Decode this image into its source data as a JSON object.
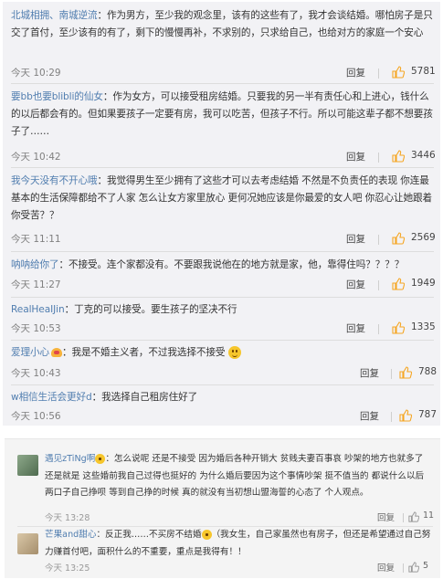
{
  "comments": [
    {
      "user": "北城相拥、南城逆流",
      "text": "：作为男方，至少我的观念里，该有的这些有了，我才会谈结婚。哪怕房子是只交了首付，至少该有的有了，剩下的慢慢再补，不求别的，只求给自己，也给对方的家庭一个安心",
      "time": "今天 10:29",
      "reply": "回复",
      "likes": "5781"
    },
    {
      "user": "要bb也要blibli的仙女",
      "text": "：作为女方，可以接受租房结婚。只要我的另一半有责任心和上进心，钱什么的以后都会有的。但如果要孩子一定要有房，我可以吃苦，但孩子不行。所以可能这辈子都不想要孩子了……",
      "time": "今天 10:42",
      "reply": "回复",
      "likes": "3446"
    },
    {
      "user": "我今天没有不开心哦",
      "text": "：我觉得男生至少拥有了这些才可以去考虑结婚 不然是不负责任的表现 你连最基本的生活保障都给不了人家 怎么让女方家里放心 更何况她应该是你最爱的女人吧 你忍心让她跟着你受苦？？",
      "time": "今天 11:11",
      "reply": "回复",
      "likes": "2569"
    },
    {
      "user": "呐呐给你了",
      "text": "：不接受。连个家都没有。不要跟我说他在的地方就是家，他，靠得住吗？？？？",
      "time": "今天 11:27",
      "reply": "回复",
      "likes": "1949"
    },
    {
      "user": "RealHeaIJin",
      "text": "：丁克的可以接受。要生孩子的坚决不行",
      "time": "今天 10:53",
      "reply": "回复",
      "likes": "1335"
    },
    {
      "user": "爱理小心",
      "text": "：我是不婚主义者，不过我选择不接受",
      "time": "今天 10:43",
      "reply": "回复",
      "likes": "788"
    },
    {
      "user": "w相信生活会更好d",
      "text": "：我选择自己租房住好了",
      "time": "今天 10:56",
      "reply": "回复",
      "likes": "787"
    }
  ],
  "bottom": [
    {
      "user": "遇见zTiNg啊",
      "text": "：怎么说呢 还是不接受 因为婚后各种开销大 贫贱夫妻百事哀 吵架的地方也就多了 还是就是 这些婚前我自己过得也挺好的 为什么婚后要因为这个事情吵架 挺不值当的 都说什么以后两口子自己挣呗 等到自己挣的时候 真的就没有当初想山盟海誓的心态了 个人观点。",
      "time": "今天 13:28",
      "reply": "回复",
      "likes": "11"
    },
    {
      "user": "芒果and甜心",
      "text": "：反正我……不买房不结婚",
      "text2": "（我女生，自己家虽然也有房子，但还是希望通过自己努力赚首付吧，面积什么的不重要，重点是我得有！！",
      "time": "今天 13:25",
      "reply": "回复",
      "likes": "5"
    }
  ]
}
